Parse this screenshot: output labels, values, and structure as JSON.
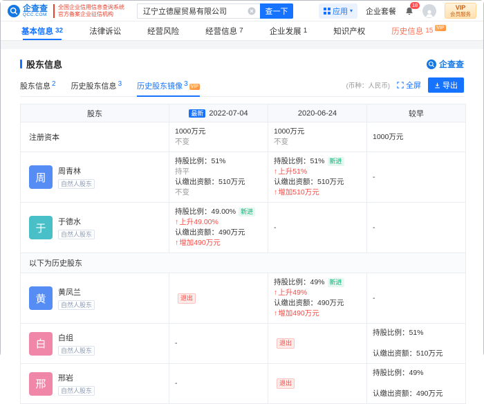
{
  "colors": {
    "accent_blue": "#1673ff",
    "logo_blue": "#1377e4",
    "danger_red": "#f54a45",
    "success_green": "#00b578",
    "history_tab_orange": "#ff7052",
    "seal_red": "#e8422e",
    "vip_gold": "#ffe2b0"
  },
  "header": {
    "logo": {
      "name": "企查查",
      "domain": "QCC.COM"
    },
    "seal": [
      "全国企业信用信息查询系统",
      "官方备案企业征信机构"
    ],
    "search": {
      "value": "辽宁立德屋贸易有限公司",
      "button": "查一下"
    },
    "actions": {
      "app": "应用",
      "package": "企业套餐",
      "notifications": "18",
      "vip_line1": "VIP",
      "vip_line2": "会员服务"
    }
  },
  "nav": {
    "tabs": [
      {
        "label": "基本信息",
        "count": "32",
        "active": true
      },
      {
        "label": "法律诉讼"
      },
      {
        "label": "经营风险"
      },
      {
        "label": "经营信息",
        "count": "7"
      },
      {
        "label": "企业发展",
        "count": "1"
      },
      {
        "label": "知识产权"
      },
      {
        "label": "历史信息",
        "count": "15",
        "highlight": true,
        "vip": true
      }
    ]
  },
  "section": {
    "title": "股东信息",
    "brand": "企查查",
    "subtabs": [
      {
        "label": "股东信息",
        "count": "2"
      },
      {
        "label": "历史股东信息",
        "count": "3"
      },
      {
        "label": "历史股东镜像",
        "count": "3",
        "active": true,
        "vip": true
      }
    ],
    "currency_note": "(币种：人民币)",
    "fullscreen_label": "全屏",
    "export_label": "导出"
  },
  "table": {
    "columns": [
      {
        "label": "股东"
      },
      {
        "label": "2022-07-04",
        "badge": "最新"
      },
      {
        "label": "2020-06-24"
      },
      {
        "label": "较早"
      }
    ],
    "rows": [
      {
        "type": "capital",
        "label": "注册资本",
        "cells": [
          {
            "lines": [
              {
                "text": "1000万元"
              },
              {
                "text": "不变",
                "muted": true
              }
            ]
          },
          {
            "lines": [
              {
                "text": "1000万元"
              },
              {
                "text": "不变",
                "muted": true
              }
            ]
          },
          {
            "lines": [
              {
                "text": "1000万元"
              }
            ]
          }
        ]
      },
      {
        "type": "shareholder",
        "name": "周青林",
        "avatar": "周",
        "avatar_color": "#568df4",
        "tag": "自然人股东",
        "cells": [
          {
            "lines": [
              {
                "text": "持股比例：51%"
              },
              {
                "text": "持平",
                "muted": true
              },
              {
                "text": "认缴出资额：510万元"
              },
              {
                "text": "不变",
                "muted": true
              }
            ]
          },
          {
            "lines": [
              {
                "text": "持股比例：51%",
                "badge": "新进"
              },
              {
                "text": "上升51%",
                "trend": "up"
              },
              {
                "text": "认缴出资额：510万元"
              },
              {
                "text": "增加510万元",
                "trend": "up"
              }
            ]
          },
          {
            "lines": [
              {
                "text": "-"
              }
            ]
          }
        ]
      },
      {
        "type": "shareholder",
        "name": "于德水",
        "avatar": "于",
        "avatar_color": "#49c0c8",
        "tag": "自然人股东",
        "cells": [
          {
            "lines": [
              {
                "text": "持股比例：49.00%",
                "badge": "新进"
              },
              {
                "text": "上升49.00%",
                "trend": "up"
              },
              {
                "text": "认缴出资额：490万元"
              },
              {
                "text": "增加490万元",
                "trend": "up"
              }
            ]
          },
          {
            "lines": [
              {
                "text": "-"
              }
            ]
          },
          {
            "lines": [
              {
                "text": "-"
              }
            ]
          }
        ]
      },
      {
        "type": "divider",
        "label": "以下为历史股东"
      },
      {
        "type": "shareholder",
        "name": "黄凤兰",
        "avatar": "黄",
        "avatar_color": "#568df4",
        "tag": "自然人股东",
        "cells": [
          {
            "lines": [
              {
                "badge": "退出"
              }
            ]
          },
          {
            "lines": [
              {
                "text": "持股比例：49%",
                "badge": "新进"
              },
              {
                "text": "上升49%",
                "trend": "up"
              },
              {
                "text": "认缴出资额：490万元"
              },
              {
                "text": "增加490万元",
                "trend": "up"
              }
            ]
          },
          {
            "lines": [
              {
                "text": "-"
              }
            ]
          }
        ]
      },
      {
        "type": "shareholder",
        "name": "白组",
        "avatar": "白",
        "avatar_color": "#f087a8",
        "tag": "自然人股东",
        "cells": [
          {
            "lines": [
              {
                "text": "-"
              }
            ]
          },
          {
            "lines": [
              {
                "badge": "退出"
              }
            ]
          },
          {
            "lines": [
              {
                "text": "持股比例：51%"
              },
              {
                "text": ""
              },
              {
                "text": "认缴出资额：510万元"
              }
            ]
          }
        ]
      },
      {
        "type": "shareholder",
        "name": "邢岩",
        "avatar": "邢",
        "avatar_color": "#f087a8",
        "tag": "自然人股东",
        "cells": [
          {
            "lines": [
              {
                "text": "-"
              }
            ]
          },
          {
            "lines": [
              {
                "badge": "退出"
              }
            ]
          },
          {
            "lines": [
              {
                "text": "持股比例：49%"
              },
              {
                "text": ""
              },
              {
                "text": "认缴出资额：490万元"
              }
            ]
          }
        ]
      }
    ]
  }
}
